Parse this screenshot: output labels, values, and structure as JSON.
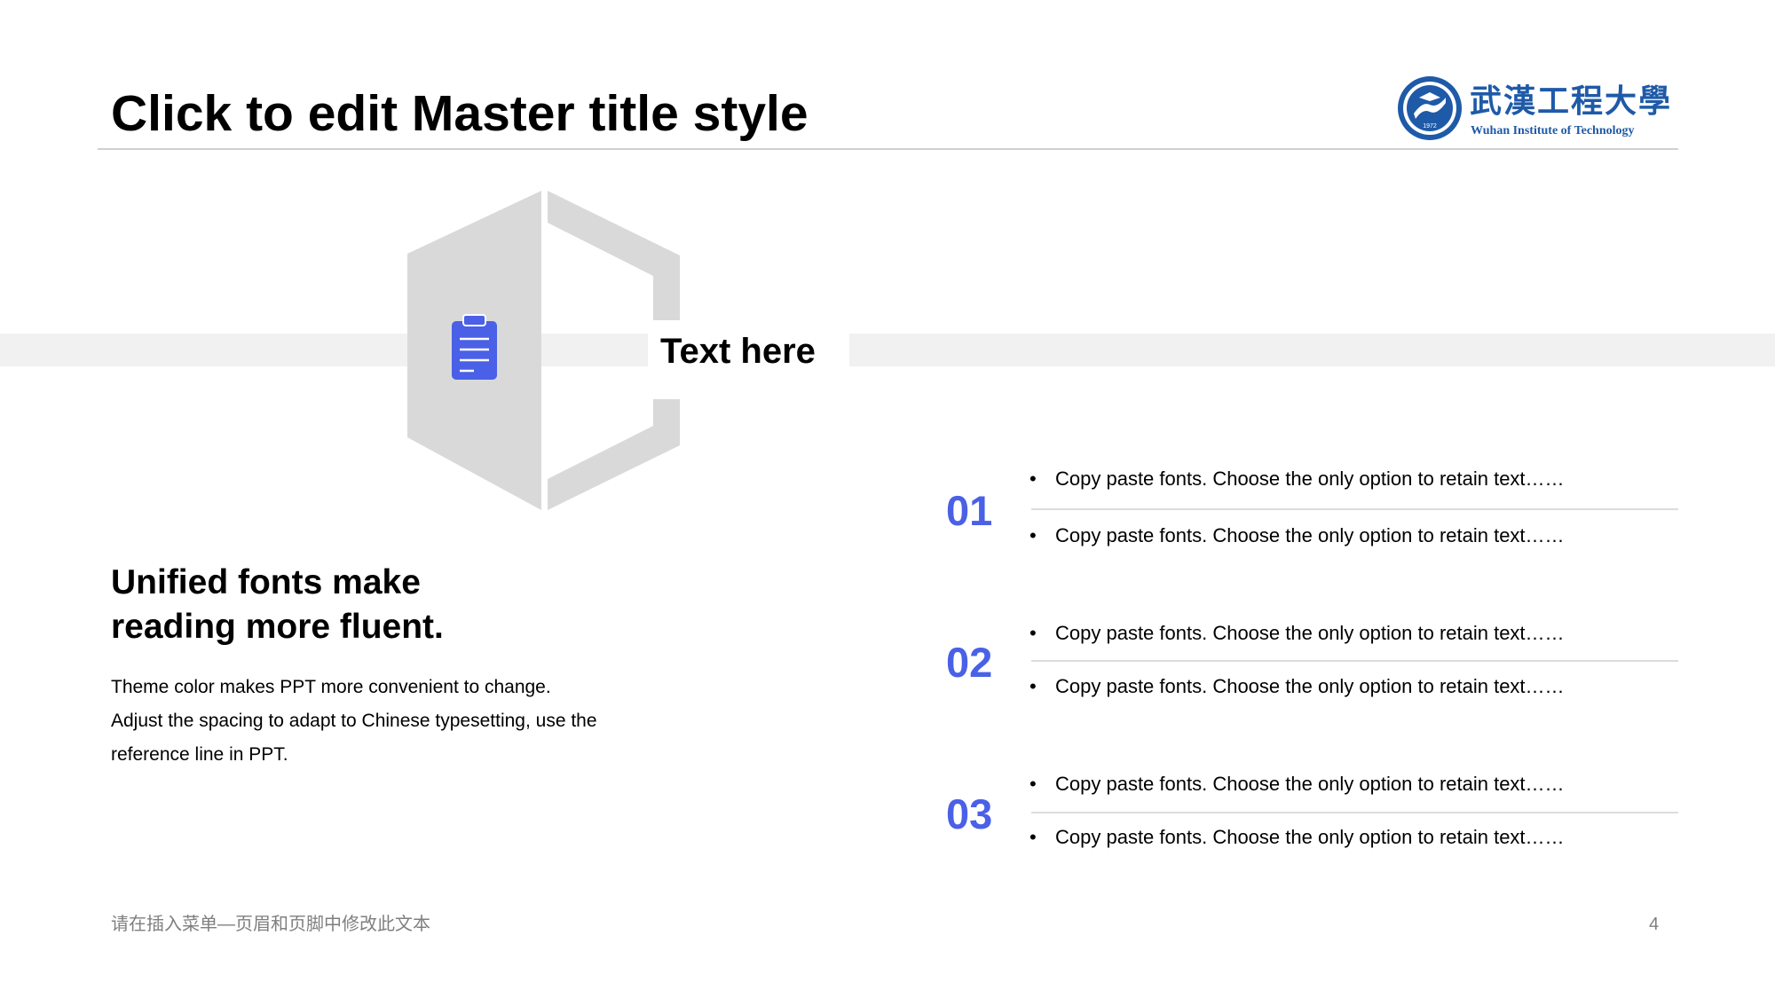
{
  "header": {
    "title": "Click to edit Master title style",
    "logo_chinese": "武漢工程大學",
    "logo_english": "Wuhan Institute of Technology",
    "logo_year": "1972"
  },
  "band": {
    "label": "Text here",
    "icon": "clipboard-icon"
  },
  "left_block": {
    "headline_line1": "Unified fonts make",
    "headline_line2": "reading more fluent.",
    "body_line1": "Theme color makes PPT more convenient to change.",
    "body_line2": "Adjust the spacing to adapt to Chinese typesetting, use the",
    "body_line3": "reference line in PPT."
  },
  "items": [
    {
      "number": "01",
      "bullets": [
        "Copy paste fonts. Choose the only option to retain text……",
        "Copy paste fonts. Choose the only option to retain text……"
      ]
    },
    {
      "number": "02",
      "bullets": [
        "Copy paste fonts. Choose the only option to retain text……",
        "Copy paste fonts. Choose the only option to retain text……"
      ]
    },
    {
      "number": "03",
      "bullets": [
        "Copy paste fonts. Choose the only option to retain text……",
        "Copy paste fonts. Choose the only option to retain text……"
      ]
    }
  ],
  "bullet_symbol": "•",
  "footer": {
    "text": "请在插入菜单—页眉和页脚中修改此文本",
    "page_number": "4"
  },
  "colors": {
    "accent": "#4a60e6",
    "logo_blue": "#1e5aa8",
    "shape_gray": "#d9d9d9",
    "band_gray": "#f1f1f1"
  }
}
